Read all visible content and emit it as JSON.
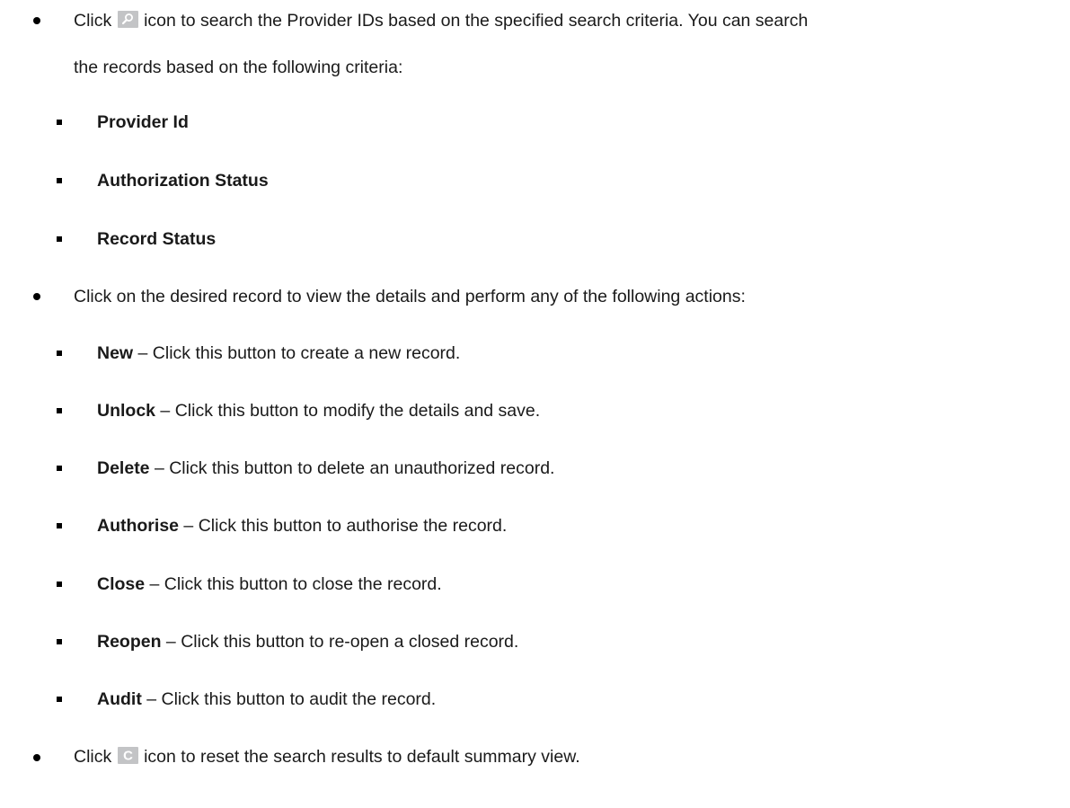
{
  "intro": {
    "prefix": "Click ",
    "search_icon": "search-icon",
    "line1_rest": " icon to search the Provider IDs based on the specified search criteria. You can search",
    "line2": "the records based on the following criteria:"
  },
  "criteria": [
    "Provider Id",
    "Authorization Status",
    "Record Status"
  ],
  "record_intro": "Click on the desired record to view the details and perform any of the following actions:",
  "actions": [
    {
      "name": "New",
      "sep": " – ",
      "desc": "Click this button to create a new record."
    },
    {
      "name": "Unlock",
      "sep": " – ",
      "desc": "Click this button to modify the details and save."
    },
    {
      "name": "Delete",
      "sep": " – ",
      "desc": "Click this button to delete an unauthorized record."
    },
    {
      "name": "Authorise",
      "sep": " – ",
      "desc": "Click this button to authorise the record."
    },
    {
      "name": "Close",
      "sep": " – ",
      "desc": "Click this button to close the record."
    },
    {
      "name": "Reopen",
      "sep": " – ",
      "desc": "Click this button to re-open a closed record."
    },
    {
      "name": "Audit",
      "sep": " – ",
      "desc": "Click this button to audit the record."
    }
  ],
  "reset": {
    "prefix": "Click ",
    "reset_icon": "reset-icon",
    "rest": " icon to reset the search results to default summary view."
  },
  "colors": {
    "icon_bg": "#c3c4c6",
    "text": "#1a1a1a"
  }
}
